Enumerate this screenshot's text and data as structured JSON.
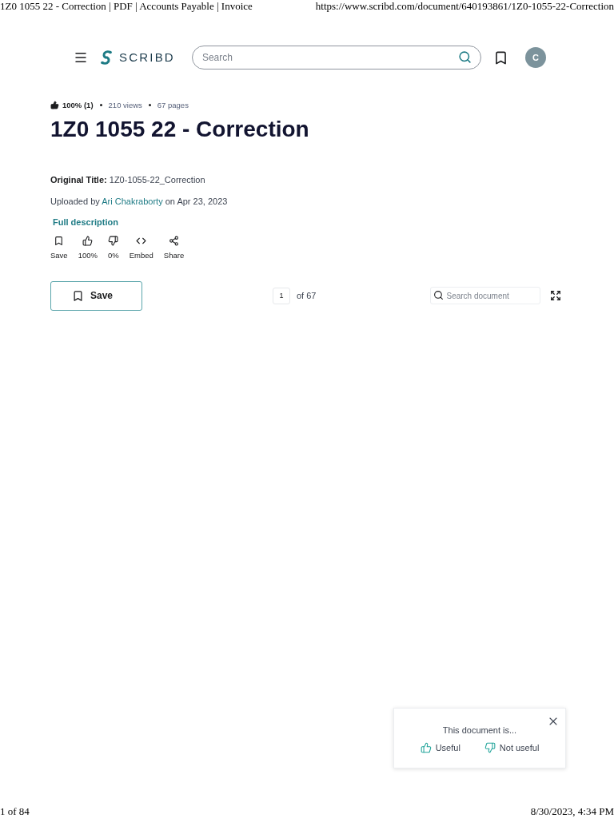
{
  "print_header": {
    "title": "1Z0 1055 22 - Correction | PDF | Accounts Payable | Invoice",
    "url": "https://www.scribd.com/document/640193861/1Z0-1055-22-Correction"
  },
  "nav": {
    "logo": "SCRIBD",
    "search": {
      "placeholder": "Search"
    },
    "avatar": "C"
  },
  "document": {
    "stats": {
      "rating": "100% (1)",
      "items": [
        "210 views",
        "67 pages"
      ]
    },
    "title": "1Z0 1055 22 - Correction",
    "original_title": "**Original Title:** 1Z0-1055-22_Correction",
    "uploaded": {
      "prefix": "Uploaded by",
      "author": "Ari Chakraborty",
      "suffix": "on Apr 23, 2023"
    },
    "full_description": "Full description",
    "actions": [
      {
        "kind": "save",
        "label": "Save"
      },
      {
        "kind": "like",
        "label": "100%"
      },
      {
        "kind": "dislike",
        "label": "0%"
      },
      {
        "kind": "embed",
        "label": "Embed"
      },
      {
        "kind": "share",
        "label": "Share"
      }
    ]
  },
  "toolbar": {
    "save_button": "Save",
    "page": {
      "value": "1",
      "total": "of 67"
    },
    "search": {
      "placeholder": "Search document"
    }
  },
  "feedback": {
    "prompt": "This document is...",
    "options": [
      {
        "kind": "useful",
        "label": "Useful"
      },
      {
        "kind": "not_useful",
        "label": "Not useful"
      }
    ]
  },
  "print_footer": {
    "page": "1 of 84",
    "timestamp": "8/30/2023, 4:34 PM"
  }
}
